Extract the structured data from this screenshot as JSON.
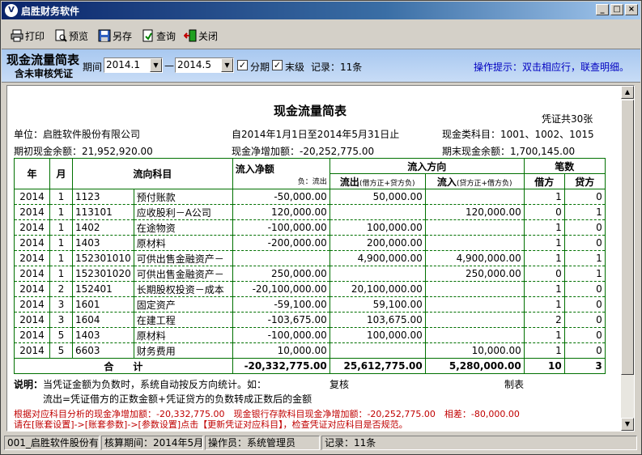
{
  "window": {
    "title": "启胜财务软件",
    "app_icon": "V"
  },
  "toolbar": {
    "print": "打印",
    "preview": "预览",
    "save_as": "另存",
    "query": "查询",
    "close": "关闭"
  },
  "filter": {
    "title": "现金流量简表",
    "subtitle": "含未审核凭证",
    "period_label": "期间",
    "period_from": "2014.1",
    "dash": "—",
    "period_to": "2014.5",
    "split_period_label": "分期",
    "split_period_checked": true,
    "leaf_label": "末级",
    "leaf_checked": true,
    "record_count": "记录：11条",
    "hint": "操作提示：双击相应行，联查明细。"
  },
  "report": {
    "title": "现金流量简表",
    "voucher_count": "凭证共30张",
    "unit": "单位：启胜软件股份有限公司",
    "date_range": "自2014年1月1日至2014年5月31日止",
    "cash_accounts": "现金类科目：1001、1002、1015",
    "opening_balance": "期初现金余额：21,952,920.00",
    "net_increase": "现金净增加额：-20,252,775.00",
    "closing_balance": "期末现金余额：1,700,145.00",
    "headers": {
      "year": "年",
      "month": "月",
      "account": "流向科目",
      "net_inflow": "流入净额",
      "net_inflow_sub": "负：流出",
      "direction": "流入方向",
      "outflow": "流出",
      "outflow_sub": "(借方正+贷方负)",
      "inflow": "流入",
      "inflow_sub": "(贷方正+借方负)",
      "count": "笔数",
      "debit": "借方",
      "credit": "贷方"
    },
    "rows": [
      {
        "year": "2014",
        "month": "1",
        "code": "1123",
        "name": "预付账款",
        "net": "-50,000.00",
        "out": "50,000.00",
        "in": "",
        "debit": "1",
        "credit": "0"
      },
      {
        "year": "2014",
        "month": "1",
        "code": "113101",
        "name": "应收股利－A公司",
        "net": "120,000.00",
        "out": "",
        "in": "120,000.00",
        "debit": "0",
        "credit": "1"
      },
      {
        "year": "2014",
        "month": "1",
        "code": "1402",
        "name": "在途物资",
        "net": "-100,000.00",
        "out": "100,000.00",
        "in": "",
        "debit": "1",
        "credit": "0"
      },
      {
        "year": "2014",
        "month": "1",
        "code": "1403",
        "name": "原材料",
        "net": "-200,000.00",
        "out": "200,000.00",
        "in": "",
        "debit": "1",
        "credit": "0"
      },
      {
        "year": "2014",
        "month": "1",
        "code": "152301010",
        "name": "可供出售金融资产－",
        "net": "",
        "out": "4,900,000.00",
        "in": "4,900,000.00",
        "debit": "1",
        "credit": "1"
      },
      {
        "year": "2014",
        "month": "1",
        "code": "152301020",
        "name": "可供出售金融资产－",
        "net": "250,000.00",
        "out": "",
        "in": "250,000.00",
        "debit": "0",
        "credit": "1"
      },
      {
        "year": "2014",
        "month": "2",
        "code": "152401",
        "name": "长期股权投资－成本",
        "net": "-20,100,000.00",
        "out": "20,100,000.00",
        "in": "",
        "debit": "1",
        "credit": "0"
      },
      {
        "year": "2014",
        "month": "3",
        "code": "1601",
        "name": "固定资产",
        "net": "-59,100.00",
        "out": "59,100.00",
        "in": "",
        "debit": "1",
        "credit": "0"
      },
      {
        "year": "2014",
        "month": "3",
        "code": "1604",
        "name": "在建工程",
        "net": "-103,675.00",
        "out": "103,675.00",
        "in": "",
        "debit": "2",
        "credit": "0"
      },
      {
        "year": "2014",
        "month": "5",
        "code": "1403",
        "name": "原材料",
        "net": "-100,000.00",
        "out": "100,000.00",
        "in": "",
        "debit": "1",
        "credit": "0"
      },
      {
        "year": "2014",
        "month": "5",
        "code": "6603",
        "name": "财务费用",
        "net": "10,000.00",
        "out": "",
        "in": "10,000.00",
        "debit": "1",
        "credit": "0"
      }
    ],
    "total": {
      "label": "合　　计",
      "net": "-20,332,775.00",
      "out": "25,612,775.00",
      "in": "5,280,000.00",
      "debit": "10",
      "credit": "3"
    },
    "note_label": "说明：",
    "note_line1": "当凭证金额为负数时，系统自动按反方向统计。如：",
    "note_line2": "流出=凭证借方的正数金额+凭证贷方的负数转成正数后的金额",
    "review": "复核",
    "prepared": "制表",
    "check_line1": "根据对应科目分析的现金净增加额：-20,332,775.00　现金银行存款科目现金净增加额：-20,252,775.00　相差：-80,000.00",
    "check_line2": "请在[账套设置]->[账套参数]->[参数设置]点击【更新凭证对应科目】，检查凭证对应科目是否规范。"
  },
  "status": {
    "company": "001_启胜软件股份有限公司",
    "period": "核算期间：2014年5月",
    "operator": "操作员：系统管理员",
    "records": "记录：11条"
  },
  "colors": {
    "grid": "#007000",
    "hint": "#0000c0",
    "warn": "#c00000",
    "titlebar": "#0a246a"
  }
}
